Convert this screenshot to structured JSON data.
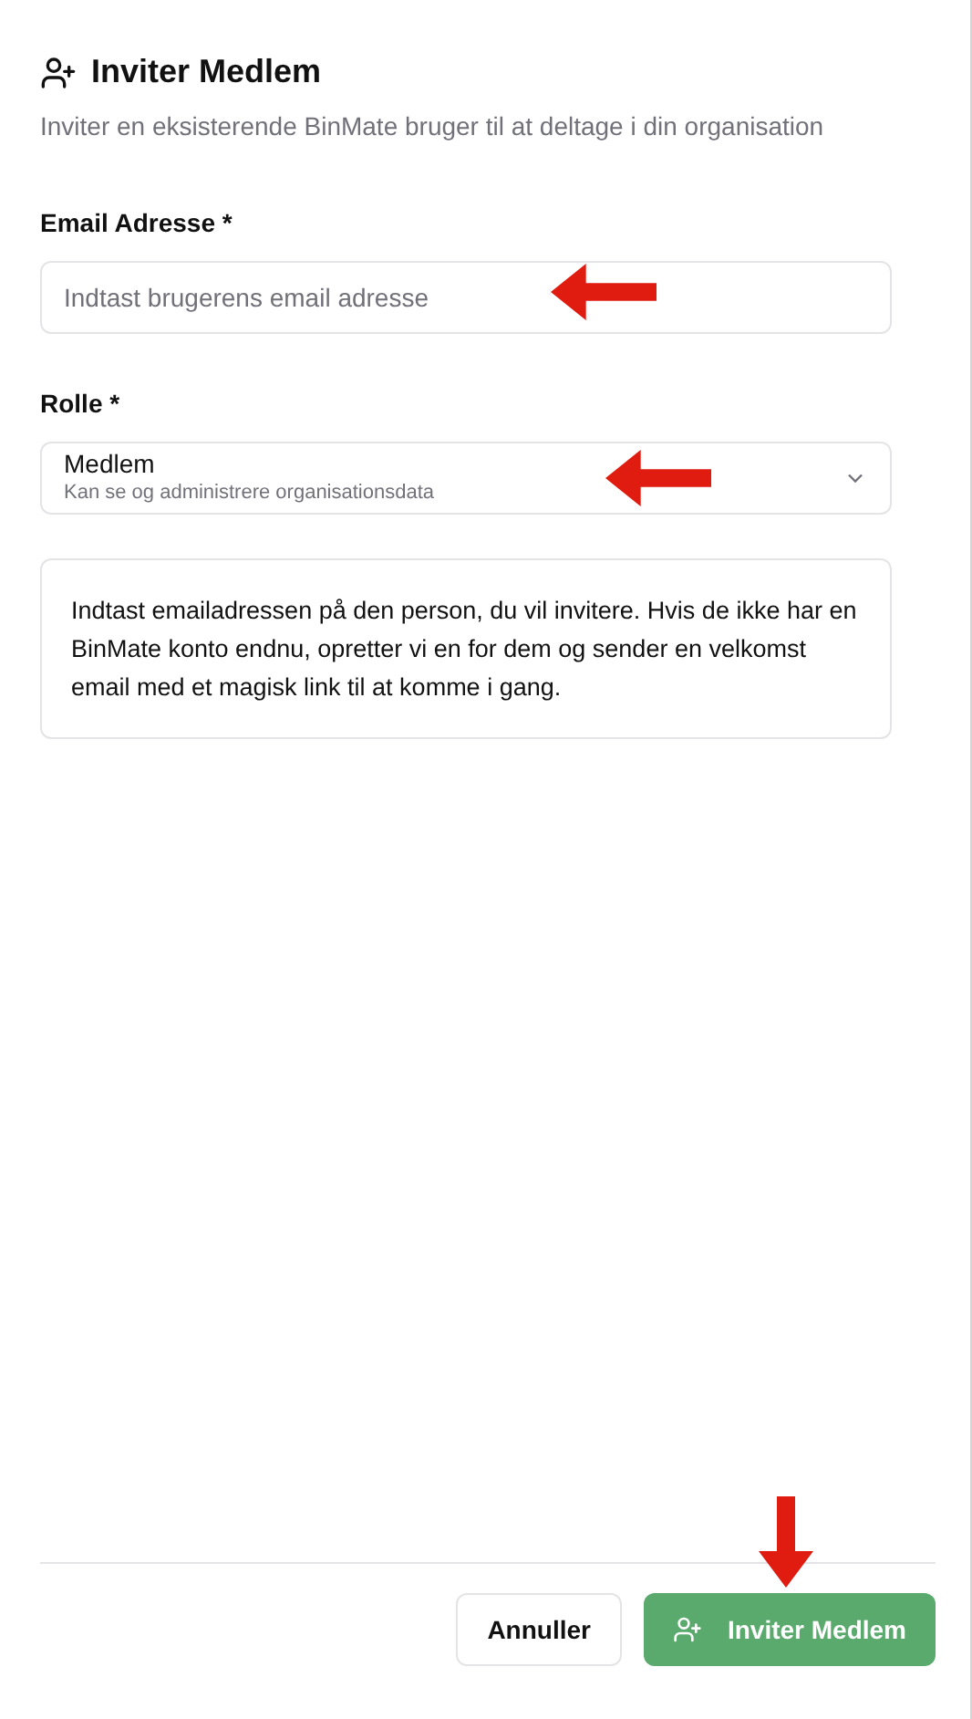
{
  "dialog": {
    "title": "Inviter Medlem",
    "description": "Inviter en eksisterende BinMate bruger til at deltage i din organisation"
  },
  "email": {
    "label": "Email Adresse *",
    "placeholder": "Indtast brugerens email adresse"
  },
  "role": {
    "label": "Rolle *",
    "value": "Medlem",
    "hint": "Kan se og administrere organisationsdata"
  },
  "info": "Indtast emailadressen på den person, du vil invitere. Hvis de ikke har en BinMate konto endnu, opretter vi en for dem og sender en velkomst email med et magisk link til at komme i gang.",
  "buttons": [
    {
      "kind": "secondary",
      "label": "Annuller"
    },
    {
      "kind": "primary",
      "label": "Inviter Medlem"
    }
  ]
}
